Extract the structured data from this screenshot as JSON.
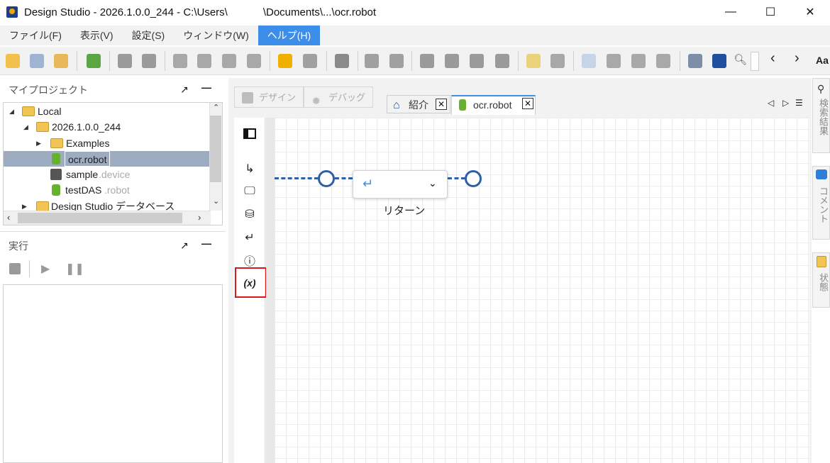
{
  "window": {
    "title": "Design Studio - 2026.1.0.0_244 - C:\\Users\\            \\Documents\\...\\ocr.robot",
    "minimize": "—",
    "maximize": "☐",
    "close": "✕"
  },
  "menu": {
    "items": [
      "ファイル(F)",
      "表示(V)",
      "設定(S)",
      "ウィンドウ(W)",
      "ヘルプ(H)"
    ],
    "active_index": 4
  },
  "toolbar": {
    "font_label": "Aa",
    "prev": "‹",
    "next": "›"
  },
  "project_panel": {
    "title": "マイプロジェクト",
    "tree": [
      {
        "label": "Local",
        "suffix": "",
        "type": "folder",
        "expanded": true
      },
      {
        "label": "2026.1.0.0_244",
        "suffix": "",
        "type": "folder",
        "expanded": true
      },
      {
        "label": "Examples",
        "suffix": "",
        "type": "folder",
        "expanded": false
      },
      {
        "label": "ocr.robot",
        "suffix": "",
        "type": "robot",
        "selected": true
      },
      {
        "label": "sample",
        "suffix": ".device",
        "type": "device"
      },
      {
        "label": "testDAS",
        "suffix": ".robot",
        "type": "robot"
      },
      {
        "label": "Design Studio データベース",
        "suffix": "",
        "type": "folder",
        "expanded": false
      }
    ]
  },
  "run_panel": {
    "title": "実行"
  },
  "editor": {
    "mode_tabs": [
      "デザイン",
      "デバッグ"
    ],
    "doc_tabs": [
      {
        "label": "紹介",
        "active": false
      },
      {
        "label": "ocr.robot",
        "active": true
      }
    ],
    "step": {
      "label": "リターン"
    }
  },
  "side_tabs": [
    "検索結果",
    "コメント",
    "状態"
  ],
  "colors": {
    "accent": "#3d8ee8",
    "flow": "#2f5fa8",
    "highlight": "#d7191c",
    "selected_row": "#9eacc2"
  }
}
